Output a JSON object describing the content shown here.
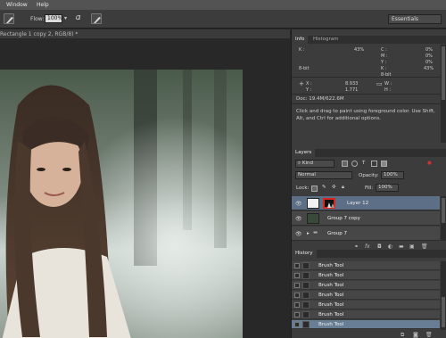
{
  "menubar": {
    "window": "Window",
    "help": "Help"
  },
  "options": {
    "flow_label": "Flow:",
    "flow_value": "100%",
    "workspace": "Essentials"
  },
  "document": {
    "tab_title": "Rectangle 1 copy 2, RGB/8) *"
  },
  "info_panel": {
    "tabs": [
      "Info",
      "Histogram"
    ],
    "k_label": "K :",
    "k_value": "43%",
    "c_label": "C :",
    "c_value": "0%",
    "m_label": "M :",
    "m_value": "0%",
    "y_label": "Y :",
    "y_value": "0%",
    "k2_label": "K :",
    "k2_value": "43%",
    "bit_left": "8-bit",
    "bit_right": "8-bit",
    "x_label": "X :",
    "x_value": "8.933",
    "y2_label": "Y :",
    "y2_value": "1.771",
    "w_label": "W :",
    "h_label": "H :",
    "doc_size": "Doc: 19.4M/622.6M",
    "hint": "Click and drag to paint using foreground color. Use Shift, Alt, and Ctrl for additional options."
  },
  "layers_panel": {
    "title": "Layers",
    "kind": "Kind",
    "blend_mode": "Normal",
    "opacity_label": "Opacity:",
    "opacity_value": "100%",
    "lock_label": "Lock:",
    "fill_label": "Fill:",
    "fill_value": "100%",
    "layers": [
      {
        "name": "Layer 12"
      },
      {
        "name": "Group 7 copy"
      },
      {
        "name": "Group 7"
      }
    ],
    "footer_fx": "fx"
  },
  "history_panel": {
    "title": "History",
    "items": [
      "Brush Tool",
      "Brush Tool",
      "Brush Tool",
      "Brush Tool",
      "Brush Tool",
      "Brush Tool",
      "Brush Tool"
    ]
  },
  "colors": {
    "accent_selected": "#5c6f86",
    "highlight_box": "#d8281e"
  }
}
